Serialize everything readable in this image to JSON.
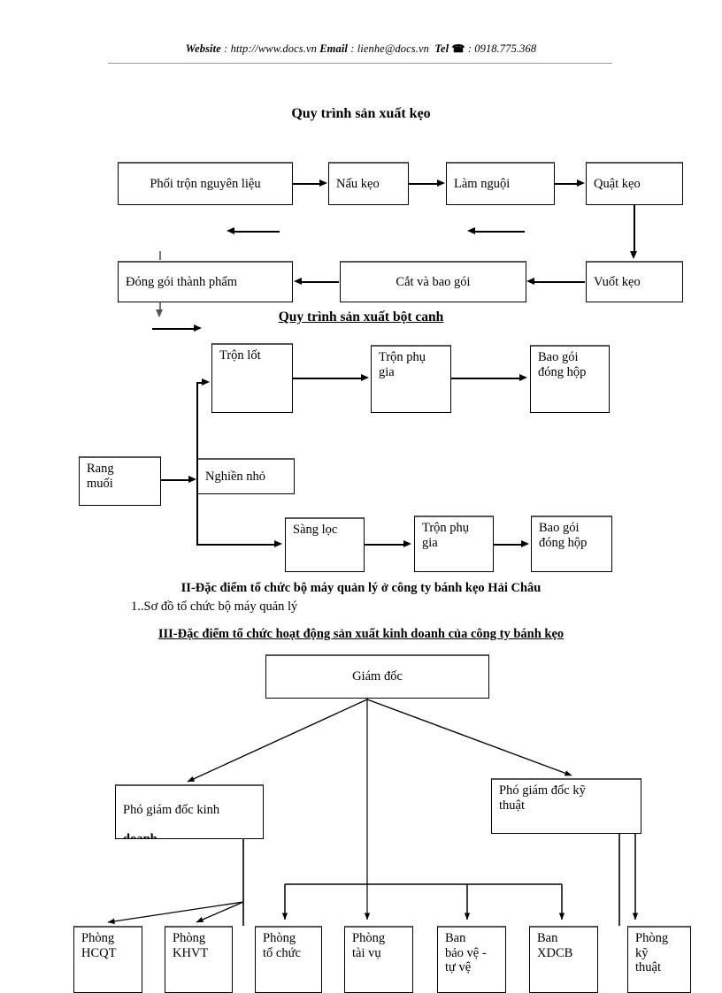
{
  "header": {
    "website_label": "Website",
    "website_url": ": http://www.docs.vn",
    "email_label": "Email",
    "email_value": ": lienhe@docs.vn",
    "tel_label": "Tel",
    "tel_icon": "telephone-icon",
    "tel_glyph": "☎",
    "tel_value": ": 0918.775.368"
  },
  "candy": {
    "title": "Quy trình sản xuất kẹo",
    "boxes": {
      "mix": "Phối trộn nguyên liệu",
      "cook": "Nấu kẹo",
      "cool": "Làm nguội",
      "beat": "Quật kẹo",
      "stretch": "Vuốt kẹo",
      "cutwrap": "Cắt và bao gói",
      "pack": "Đóng gói thành phẩm"
    }
  },
  "seasoning": {
    "title": "Quy trình sản xuất bột canh",
    "boxes": {
      "mix_base": "Trộn lốt",
      "mix_additive_top": "Trộn phụ\ngia",
      "pack_top": "Bao gói\nđóng hộp",
      "roast_salt": "Rang\nmuối",
      "grind": "Nghiền nhỏ",
      "sieve": "Sàng lọc",
      "mix_additive_bottom": "Trộn phụ\ngia",
      "pack_bottom": "Bao gói\nđóng hộp"
    }
  },
  "sections": {
    "heading_2": "II-Đặc điểm tổ chức bộ máy quản lý ở công ty bánh kẹo Hải Châu",
    "subheading_2_1": "1..Sơ đồ tổ chức bộ máy quản lý",
    "heading_3": "III-Đặc điểm tổ chức hoạt động sản xuất kinh doanh của công ty bánh kẹo"
  },
  "orgchart": {
    "director": "Giám đốc",
    "deputy_sales_line1": "Phó giám đốc kinh",
    "deputy_sales_line2": "doanh",
    "deputy_tech": "Phó giám đốc kỹ\nthuật",
    "departments": [
      "Phòng\nHCQT",
      "Phòng\nKHVT",
      "Phòng\ntổ chức",
      "Phòng\ntài vụ",
      "Ban\nbảo vệ -\ntự vệ",
      "Ban\nXDCB",
      "Phòng\nkỹ\nthuật"
    ]
  },
  "colors": {
    "ink": "#000000",
    "page": "#ffffff",
    "rule": "#9a9a9a"
  }
}
